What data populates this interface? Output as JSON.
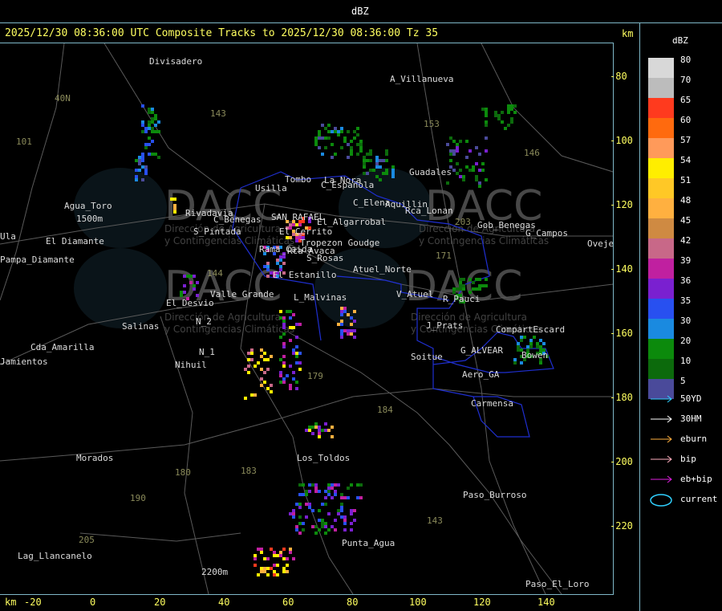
{
  "window_title": "dBZ",
  "header": {
    "title": "2025/12/30 08:36:00 UTC Composite Tracks to 2025/12/30 08:36:00 Tz 35",
    "km_label": "km"
  },
  "legend": {
    "title": "dBZ",
    "levels": [
      {
        "value": "80",
        "color": "#d8d8d8"
      },
      {
        "value": "70",
        "color": "#bcbcbc"
      },
      {
        "value": "65",
        "color": "#ff3a1e"
      },
      {
        "value": "60",
        "color": "#ff6a0e"
      },
      {
        "value": "57",
        "color": "#ff9a5a"
      },
      {
        "value": "54",
        "color": "#ffee00"
      },
      {
        "value": "51",
        "color": "#ffc826"
      },
      {
        "value": "48",
        "color": "#ffb040"
      },
      {
        "value": "45",
        "color": "#cf8a42"
      },
      {
        "value": "42",
        "color": "#c86888"
      },
      {
        "value": "39",
        "color": "#c020a0"
      },
      {
        "value": "36",
        "color": "#7a20d0"
      },
      {
        "value": "35",
        "color": "#2850f0"
      },
      {
        "value": "30",
        "color": "#1a8ae0"
      },
      {
        "value": "20",
        "color": "#0c8a0c"
      },
      {
        "value": "10",
        "color": "#0c6a0c"
      },
      {
        "value": "5",
        "color": "#4a4a9a"
      }
    ],
    "tracks": [
      {
        "label": "50YD",
        "color": "#30d0ff"
      },
      {
        "label": "30HM",
        "color": "#ffffff"
      },
      {
        "label": "eburn",
        "color": "#ffb040"
      },
      {
        "label": "bip",
        "color": "#ffb0c0"
      },
      {
        "label": "eb+bip",
        "color": "#e020e0"
      },
      {
        "label": "current",
        "color": "#30d0ff"
      }
    ]
  },
  "axes": {
    "x_unit": "km",
    "x_ticks": [
      "-20",
      "0",
      "20",
      "40",
      "60",
      "80",
      "100",
      "120",
      "140"
    ],
    "y_ticks": [
      "-80",
      "-100",
      "-120",
      "-140",
      "-160",
      "-180",
      "-200",
      "-220"
    ]
  },
  "watermark": {
    "logo": "DACC",
    "line1": "Dirección de Agricultura",
    "line2": "y Contingencias Climáticas"
  },
  "places": [
    {
      "name": "Divisadero"
    },
    {
      "name": "A_Villanueva"
    },
    {
      "name": "Guadales"
    },
    {
      "name": "Tombo"
    },
    {
      "name": "Usilla"
    },
    {
      "name": "La Nora"
    },
    {
      "name": "C_Española"
    },
    {
      "name": "C_Elena"
    },
    {
      "name": "Aquillin"
    },
    {
      "name": "Rca_Lonan"
    },
    {
      "name": "Agua_Toro"
    },
    {
      "name": "1500m"
    },
    {
      "name": "Rivadavia"
    },
    {
      "name": "El Diamante"
    },
    {
      "name": "Pampa_Diamante"
    },
    {
      "name": "Rama_Caida"
    },
    {
      "name": "C_Benegas"
    },
    {
      "name": "SAN_RAFAEL"
    },
    {
      "name": "El_Algarrobal"
    },
    {
      "name": "S_Pintada"
    },
    {
      "name": "El Cerrito"
    },
    {
      "name": "Tropezon Goudge"
    },
    {
      "name": "Rca Avaca"
    },
    {
      "name": "S_Rosas"
    },
    {
      "name": "Atuel_Norte"
    },
    {
      "name": "Gob_Benegas"
    },
    {
      "name": "G_Campos"
    },
    {
      "name": "Ovejeria"
    },
    {
      "name": "El Estanillo"
    },
    {
      "name": "Valle Grande"
    },
    {
      "name": "L_Malvinas"
    },
    {
      "name": "V_Atuel"
    },
    {
      "name": "R_Pauci"
    },
    {
      "name": "El_Desvio"
    },
    {
      "name": "Salinas"
    },
    {
      "name": "N_2"
    },
    {
      "name": "J_Prats"
    },
    {
      "name": "CompartEscard"
    },
    {
      "name": "Cda_Amarilla"
    },
    {
      "name": "N_1"
    },
    {
      "name": "Nihuil"
    },
    {
      "name": "Soitue"
    },
    {
      "name": "G_ALVEAR"
    },
    {
      "name": "Aero_GA"
    },
    {
      "name": "Bowen"
    },
    {
      "name": "Carmensa"
    },
    {
      "name": "Los_Toldos"
    },
    {
      "name": "Morados"
    },
    {
      "name": "Paso_Burroso"
    },
    {
      "name": "Punta_Agua"
    },
    {
      "name": "Lag_Llancanelo"
    },
    {
      "name": "Paso_El_Loro"
    },
    {
      "name": "2200m"
    },
    {
      "name": "Jamientos"
    },
    {
      "name": "Ula"
    }
  ],
  "route_labels": [
    "143",
    "153",
    "146",
    "101",
    "40N",
    "171",
    "203",
    "144",
    "179",
    "184",
    "180",
    "183",
    "190",
    "205",
    "143"
  ]
}
